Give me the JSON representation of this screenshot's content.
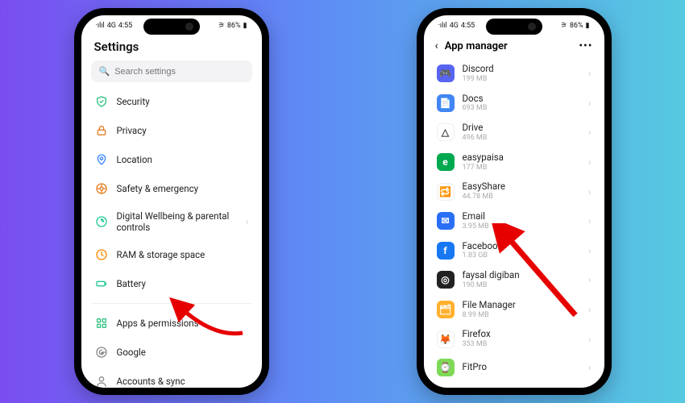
{
  "status": {
    "carrier": "·ılıl",
    "net": "4G",
    "time": "4:55",
    "right": "86%"
  },
  "phone1": {
    "title": "Settings",
    "search_placeholder": "Search settings",
    "items": [
      {
        "name": "security",
        "label": "Security",
        "icon": "shield"
      },
      {
        "name": "privacy",
        "label": "Privacy",
        "icon": "lock"
      },
      {
        "name": "location",
        "label": "Location",
        "icon": "pin"
      },
      {
        "name": "safety",
        "label": "Safety & emergency",
        "icon": "life"
      },
      {
        "name": "wellbeing",
        "label": "Digital Wellbeing & parental controls",
        "icon": "leaf"
      },
      {
        "name": "ram",
        "label": "RAM & storage space",
        "icon": "clock"
      },
      {
        "name": "battery",
        "label": "Battery",
        "icon": "battery"
      }
    ],
    "items2": [
      {
        "name": "apps",
        "label": "Apps & permissions",
        "icon": "grid"
      },
      {
        "name": "google",
        "label": "Google",
        "icon": "google"
      },
      {
        "name": "accounts",
        "label": "Accounts & sync",
        "icon": "person"
      }
    ]
  },
  "phone2": {
    "title": "App manager",
    "apps": [
      {
        "name": "discord",
        "label": "Discord",
        "size": "199 MB",
        "bg": "#5865F2",
        "glyph": "🎮"
      },
      {
        "name": "docs",
        "label": "Docs",
        "size": "693 MB",
        "bg": "#4285f4",
        "glyph": "📄"
      },
      {
        "name": "drive",
        "label": "Drive",
        "size": "496 MB",
        "bg": "#ffffff",
        "glyph": "△"
      },
      {
        "name": "easypaisa",
        "label": "easypaisa",
        "size": "177 MB",
        "bg": "#00a84f",
        "glyph": "e"
      },
      {
        "name": "easyshare",
        "label": "EasyShare",
        "size": "44.78 MB",
        "bg": "#ffffff",
        "glyph": "🔁"
      },
      {
        "name": "email",
        "label": "Email",
        "size": "3.95 MB",
        "bg": "#2a6ef5",
        "glyph": "✉"
      },
      {
        "name": "facebook",
        "label": "Facebook",
        "size": "1.83 GB",
        "bg": "#1877f2",
        "glyph": "f"
      },
      {
        "name": "faysal",
        "label": "faysal digiban",
        "size": "190 MB",
        "bg": "#222222",
        "glyph": "◎"
      },
      {
        "name": "filemgr",
        "label": "File Manager",
        "size": "8.99 MB",
        "bg": "#ffb02e",
        "glyph": "🗂"
      },
      {
        "name": "firefox",
        "label": "Firefox",
        "size": "353 MB",
        "bg": "#ffffff",
        "glyph": "🦊"
      },
      {
        "name": "fitpro",
        "label": "FitPro",
        "size": "",
        "bg": "#7ed957",
        "glyph": "⌚"
      }
    ]
  }
}
